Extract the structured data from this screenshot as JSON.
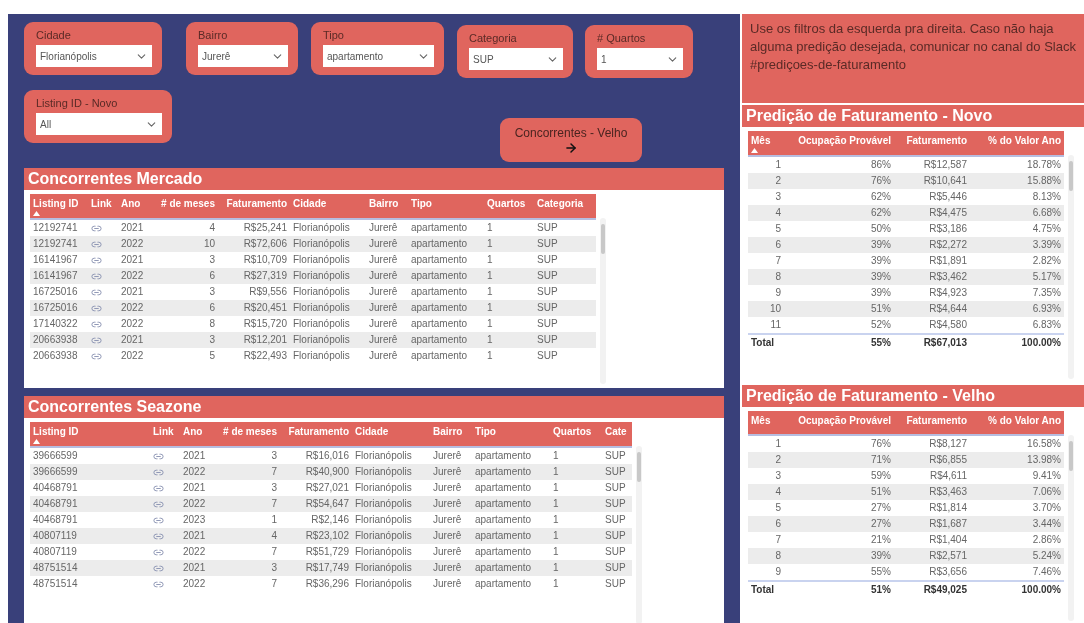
{
  "filters": [
    {
      "label": "Cidade",
      "value": "Florianópolis"
    },
    {
      "label": "Bairro",
      "value": "Jurerê"
    },
    {
      "label": "Tipo",
      "value": "apartamento"
    },
    {
      "label": "Categoria",
      "value": "SUP"
    },
    {
      "label": "# Quartos",
      "value": "1"
    }
  ],
  "listing_filter": {
    "label": "Listing ID - Novo",
    "value": "All"
  },
  "nav_button": {
    "label": "Concorrentes - Velho"
  },
  "market_table": {
    "title": "Concorrentes Mercado",
    "columns": [
      {
        "label": "Listing ID",
        "kind": "text",
        "sorted": true
      },
      {
        "label": "Link",
        "kind": "link",
        "sorted": false
      },
      {
        "label": "Ano",
        "kind": "text",
        "sorted": false
      },
      {
        "label": "# de meses",
        "kind": "number",
        "sorted": false
      },
      {
        "label": "Faturamento",
        "kind": "number",
        "sorted": false
      },
      {
        "label": "Cidade",
        "kind": "text",
        "sorted": false
      },
      {
        "label": "Bairro",
        "kind": "text",
        "sorted": false
      },
      {
        "label": "Tipo",
        "kind": "text",
        "sorted": false
      },
      {
        "label": "Quartos",
        "kind": "text",
        "sorted": false
      },
      {
        "label": "Categoria",
        "kind": "text",
        "sorted": false
      }
    ],
    "rows": [
      [
        "12192741",
        "",
        "2021",
        "4",
        "R$25,241",
        "Florianópolis",
        "Jurerê",
        "apartamento",
        "1",
        "SUP"
      ],
      [
        "12192741",
        "",
        "2022",
        "10",
        "R$72,606",
        "Florianópolis",
        "Jurerê",
        "apartamento",
        "1",
        "SUP"
      ],
      [
        "16141967",
        "",
        "2021",
        "3",
        "R$10,709",
        "Florianópolis",
        "Jurerê",
        "apartamento",
        "1",
        "SUP"
      ],
      [
        "16141967",
        "",
        "2022",
        "6",
        "R$27,319",
        "Florianópolis",
        "Jurerê",
        "apartamento",
        "1",
        "SUP"
      ],
      [
        "16725016",
        "",
        "2021",
        "3",
        "R$9,556",
        "Florianópolis",
        "Jurerê",
        "apartamento",
        "1",
        "SUP"
      ],
      [
        "16725016",
        "",
        "2022",
        "6",
        "R$20,451",
        "Florianópolis",
        "Jurerê",
        "apartamento",
        "1",
        "SUP"
      ],
      [
        "17140322",
        "",
        "2022",
        "8",
        "R$15,720",
        "Florianópolis",
        "Jurerê",
        "apartamento",
        "1",
        "SUP"
      ],
      [
        "20663938",
        "",
        "2021",
        "3",
        "R$12,201",
        "Florianópolis",
        "Jurerê",
        "apartamento",
        "1",
        "SUP"
      ],
      [
        "20663938",
        "",
        "2022",
        "5",
        "R$22,493",
        "Florianópolis",
        "Jurerê",
        "apartamento",
        "1",
        "SUP"
      ]
    ]
  },
  "seazone_table": {
    "title": "Concorrentes Seazone",
    "columns": [
      {
        "label": "Listing ID",
        "kind": "text",
        "sorted": true
      },
      {
        "label": "Link",
        "kind": "link",
        "sorted": false
      },
      {
        "label": "Ano",
        "kind": "text",
        "sorted": false
      },
      {
        "label": "# de meses",
        "kind": "number",
        "sorted": false
      },
      {
        "label": "Faturamento",
        "kind": "number",
        "sorted": false
      },
      {
        "label": "Cidade",
        "kind": "text",
        "sorted": false
      },
      {
        "label": "Bairro",
        "kind": "text",
        "sorted": false
      },
      {
        "label": "Tipo",
        "kind": "text",
        "sorted": false
      },
      {
        "label": "Quartos",
        "kind": "text",
        "sorted": false
      },
      {
        "label": "Cate",
        "kind": "text",
        "sorted": false
      }
    ],
    "rows": [
      [
        "39666599",
        "",
        "2021",
        "3",
        "R$16,016",
        "Florianópolis",
        "Jurerê",
        "apartamento",
        "1",
        "SUP"
      ],
      [
        "39666599",
        "",
        "2022",
        "7",
        "R$40,900",
        "Florianópolis",
        "Jurerê",
        "apartamento",
        "1",
        "SUP"
      ],
      [
        "40468791",
        "",
        "2021",
        "3",
        "R$27,021",
        "Florianópolis",
        "Jurerê",
        "apartamento",
        "1",
        "SUP"
      ],
      [
        "40468791",
        "",
        "2022",
        "7",
        "R$54,647",
        "Florianópolis",
        "Jurerê",
        "apartamento",
        "1",
        "SUP"
      ],
      [
        "40468791",
        "",
        "2023",
        "1",
        "R$2,146",
        "Florianópolis",
        "Jurerê",
        "apartamento",
        "1",
        "SUP"
      ],
      [
        "40807119",
        "",
        "2021",
        "4",
        "R$23,102",
        "Florianópolis",
        "Jurerê",
        "apartamento",
        "1",
        "SUP"
      ],
      [
        "40807119",
        "",
        "2022",
        "7",
        "R$51,729",
        "Florianópolis",
        "Jurerê",
        "apartamento",
        "1",
        "SUP"
      ],
      [
        "48751514",
        "",
        "2021",
        "3",
        "R$17,749",
        "Florianópolis",
        "Jurerê",
        "apartamento",
        "1",
        "SUP"
      ],
      [
        "48751514",
        "",
        "2022",
        "7",
        "R$36,296",
        "Florianópolis",
        "Jurerê",
        "apartamento",
        "1",
        "SUP"
      ]
    ]
  },
  "note": "Use os filtros da esquerda pra direita. Caso não haja alguma predição desejada, comunicar no canal do Slack #prediçoes-de-faturamento",
  "forecast_new": {
    "title": "Predição de Faturamento - Novo",
    "columns": [
      {
        "label": "Mês",
        "kind": "number",
        "sorted": true
      },
      {
        "label": "Ocupação Provável",
        "kind": "number",
        "sorted": false
      },
      {
        "label": "Faturamento",
        "kind": "number",
        "sorted": false
      },
      {
        "label": "% do Valor Ano",
        "kind": "number",
        "sorted": false
      }
    ],
    "rows": [
      [
        "1",
        "86%",
        "R$12,587",
        "18.78%"
      ],
      [
        "2",
        "76%",
        "R$10,641",
        "15.88%"
      ],
      [
        "3",
        "62%",
        "R$5,446",
        "8.13%"
      ],
      [
        "4",
        "62%",
        "R$4,475",
        "6.68%"
      ],
      [
        "5",
        "50%",
        "R$3,186",
        "4.75%"
      ],
      [
        "6",
        "39%",
        "R$2,272",
        "3.39%"
      ],
      [
        "7",
        "39%",
        "R$1,891",
        "2.82%"
      ],
      [
        "8",
        "39%",
        "R$3,462",
        "5.17%"
      ],
      [
        "9",
        "39%",
        "R$4,923",
        "7.35%"
      ],
      [
        "10",
        "51%",
        "R$4,644",
        "6.93%"
      ],
      [
        "11",
        "52%",
        "R$4,580",
        "6.83%"
      ]
    ],
    "total": [
      "Total",
      "55%",
      "R$67,013",
      "100.00%"
    ]
  },
  "forecast_old": {
    "title": "Predição de Faturamento - Velho",
    "columns": [
      {
        "label": "Mês",
        "kind": "number",
        "sorted": false
      },
      {
        "label": "Ocupação Provável",
        "kind": "number",
        "sorted": false
      },
      {
        "label": "Faturamento",
        "kind": "number",
        "sorted": false
      },
      {
        "label": "% do Valor Ano",
        "kind": "number",
        "sorted": false
      }
    ],
    "rows": [
      [
        "1",
        "76%",
        "R$8,127",
        "16.58%"
      ],
      [
        "2",
        "71%",
        "R$6,855",
        "13.98%"
      ],
      [
        "3",
        "59%",
        "R$4,611",
        "9.41%"
      ],
      [
        "4",
        "51%",
        "R$3,463",
        "7.06%"
      ],
      [
        "5",
        "27%",
        "R$1,814",
        "3.70%"
      ],
      [
        "6",
        "27%",
        "R$1,687",
        "3.44%"
      ],
      [
        "7",
        "21%",
        "R$1,404",
        "2.86%"
      ],
      [
        "8",
        "39%",
        "R$2,571",
        "5.24%"
      ],
      [
        "9",
        "55%",
        "R$3,656",
        "7.46%"
      ]
    ],
    "total": [
      "Total",
      "51%",
      "R$49,025",
      "100.00%"
    ]
  }
}
